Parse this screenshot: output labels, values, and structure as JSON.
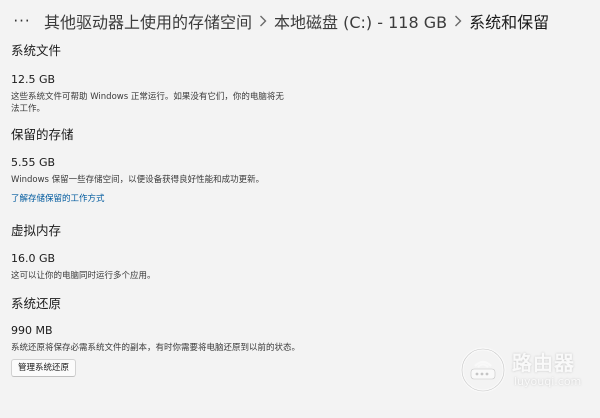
{
  "breadcrumb": {
    "more_label": "···",
    "items": [
      "其他驱动器上使用的存储空间",
      "本地磁盘 (C:) - 118 GB",
      "系统和保留"
    ]
  },
  "sections": {
    "system_files": {
      "title": "系统文件",
      "size": "12.5 GB",
      "desc_line1": "这些系统文件可帮助 Windows 正常运行。如果没有它们，你的电脑将无",
      "desc_line2": "法工作。"
    },
    "reserved": {
      "title": "保留的存储",
      "size": "5.55 GB",
      "desc": "Windows 保留一些存储空间，以便设备获得良好性能和成功更新。",
      "link": "了解存储保留的工作方式"
    },
    "virtual_memory": {
      "title": "虚拟内存",
      "size": "16.0 GB",
      "desc": "这可以让你的电脑同时运行多个应用。"
    },
    "system_restore": {
      "title": "系统还原",
      "size": "990 MB",
      "desc": "系统还原将保存必需系统文件的副本，有时你需要将电脑还原到以前的状态。",
      "button": "管理系统还原"
    }
  },
  "watermark": {
    "cn": "路由器",
    "en": "luyouqi.com"
  },
  "colors": {
    "background": "#f3f3f3",
    "link": "#005a9e",
    "text": "#1a1a1a"
  },
  "icons": {
    "more": "more-horizontal-icon",
    "separator": "chevron-right-icon",
    "watermark": "router-logo-icon"
  }
}
